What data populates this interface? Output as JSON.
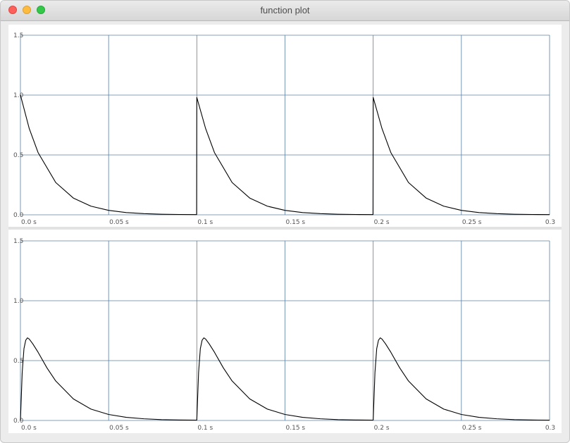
{
  "window": {
    "title": "function plot"
  },
  "colors": {
    "grid": "#5b7fa3",
    "curve": "#000000"
  },
  "chart_data": [
    {
      "type": "line",
      "title": "",
      "xlabel": "",
      "ylabel": "",
      "xlim": [
        0,
        0.3
      ],
      "ylim": [
        0,
        1.5
      ],
      "grid": true,
      "x_tick_labels": [
        "0.0 s",
        "0.05 s",
        "0.1 s",
        "0.15 s",
        "0.2 s",
        "0.25 s",
        "0.3"
      ],
      "x_ticks": [
        0,
        0.05,
        0.1,
        0.15,
        0.2,
        0.25,
        0.3
      ],
      "y_tick_labels": [
        "0.0",
        "0.5",
        "1.0",
        "1.5"
      ],
      "y_ticks": [
        0,
        0.5,
        1.0,
        1.5
      ],
      "series": [
        {
          "x": [
            0,
            0.005,
            0.01,
            0.02,
            0.03,
            0.04,
            0.05,
            0.06,
            0.07,
            0.08,
            0.09,
            0.0999,
            0.1,
            0.105,
            0.11,
            0.12,
            0.13,
            0.14,
            0.15,
            0.16,
            0.17,
            0.18,
            0.19,
            0.1999,
            0.2,
            0.205,
            0.21,
            0.22,
            0.23,
            0.24,
            0.25,
            0.26,
            0.27,
            0.28,
            0.29,
            0.3
          ],
          "y": [
            1.0,
            0.72,
            0.52,
            0.27,
            0.14,
            0.072,
            0.037,
            0.019,
            0.01,
            0.005,
            0.003,
            0.002,
            0.98,
            0.72,
            0.52,
            0.27,
            0.14,
            0.072,
            0.037,
            0.019,
            0.01,
            0.005,
            0.003,
            0.002,
            0.98,
            0.72,
            0.52,
            0.27,
            0.14,
            0.072,
            0.037,
            0.019,
            0.01,
            0.005,
            0.003,
            0.002
          ]
        }
      ]
    },
    {
      "type": "line",
      "title": "",
      "xlabel": "",
      "ylabel": "",
      "xlim": [
        0,
        0.3
      ],
      "ylim": [
        0,
        1.5
      ],
      "grid": true,
      "x_tick_labels": [
        "0.0 s",
        "0.05 s",
        "0.1 s",
        "0.15 s",
        "0.2 s",
        "0.25 s",
        "0.3"
      ],
      "x_ticks": [
        0,
        0.05,
        0.1,
        0.15,
        0.2,
        0.25,
        0.3
      ],
      "y_tick_labels": [
        "0.0",
        "0.5",
        "1.0",
        "1.5"
      ],
      "y_ticks": [
        0,
        0.5,
        1.0,
        1.5
      ],
      "series": [
        {
          "x": [
            0,
            0.001,
            0.002,
            0.003,
            0.004,
            0.005,
            0.007,
            0.01,
            0.015,
            0.02,
            0.03,
            0.04,
            0.05,
            0.06,
            0.07,
            0.08,
            0.09,
            0.0999,
            0.1,
            0.101,
            0.102,
            0.103,
            0.104,
            0.105,
            0.107,
            0.11,
            0.115,
            0.12,
            0.13,
            0.14,
            0.15,
            0.16,
            0.17,
            0.18,
            0.19,
            0.1999,
            0.2,
            0.201,
            0.202,
            0.203,
            0.204,
            0.205,
            0.207,
            0.21,
            0.215,
            0.22,
            0.23,
            0.24,
            0.25,
            0.26,
            0.27,
            0.28,
            0.29,
            0.3
          ],
          "y": [
            0,
            0.4,
            0.6,
            0.67,
            0.69,
            0.68,
            0.64,
            0.57,
            0.44,
            0.33,
            0.18,
            0.095,
            0.05,
            0.026,
            0.014,
            0.007,
            0.004,
            0.003,
            0.003,
            0.4,
            0.6,
            0.67,
            0.69,
            0.68,
            0.64,
            0.57,
            0.44,
            0.33,
            0.18,
            0.095,
            0.05,
            0.026,
            0.014,
            0.007,
            0.004,
            0.003,
            0.003,
            0.4,
            0.6,
            0.67,
            0.69,
            0.68,
            0.64,
            0.57,
            0.44,
            0.33,
            0.18,
            0.095,
            0.05,
            0.026,
            0.014,
            0.007,
            0.004,
            0.003
          ]
        }
      ]
    }
  ]
}
